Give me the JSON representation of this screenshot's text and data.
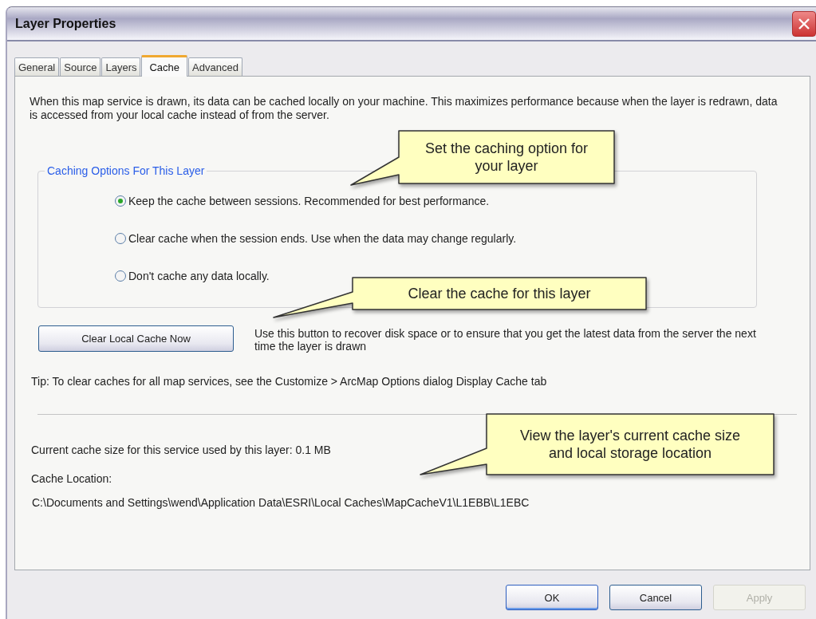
{
  "window": {
    "title": "Layer Properties"
  },
  "tabs": [
    {
      "label": "General",
      "selected": false
    },
    {
      "label": "Source",
      "selected": false
    },
    {
      "label": "Layers",
      "selected": false
    },
    {
      "label": "Cache",
      "selected": true
    },
    {
      "label": "Advanced",
      "selected": false
    }
  ],
  "intro": "When this map service is drawn, its data can be cached locally on your machine. This maximizes performance because when the layer is redrawn, data is accessed from your local cache instead of from the server.",
  "caching_options": {
    "title": "Caching Options For This Layer",
    "options": [
      {
        "label": "Keep the cache between sessions. Recommended for best performance.",
        "selected": true
      },
      {
        "label": "Clear cache when the session ends. Use when the data may change regularly.",
        "selected": false
      },
      {
        "label": "Don't cache any data locally.",
        "selected": false
      }
    ]
  },
  "clear_button": "Clear Local Cache Now",
  "clear_description": "Use this button to recover disk space or to ensure that you get the latest data from the server the next time the layer is drawn",
  "tip": "Tip: To clear caches for all map services, see the Customize > ArcMap Options dialog Display Cache tab",
  "cache_size": "Current cache size for this service used by this layer: 0.1 MB",
  "cache_location_label": "Cache Location:",
  "cache_location": "C:\\Documents and Settings\\wend\\Application Data\\ESRI\\Local Caches\\MapCacheV1\\L1EBB\\L1EBC",
  "callouts": [
    {
      "text": "Set the caching option for your layer"
    },
    {
      "text": "Clear the cache for this layer"
    },
    {
      "text": "View the layer's current cache size and local storage location"
    }
  ],
  "buttons": [
    {
      "label": "OK",
      "disabled": false,
      "default": true
    },
    {
      "label": "Cancel",
      "disabled": false,
      "default": false
    },
    {
      "label": "Apply",
      "disabled": true,
      "default": false
    }
  ]
}
